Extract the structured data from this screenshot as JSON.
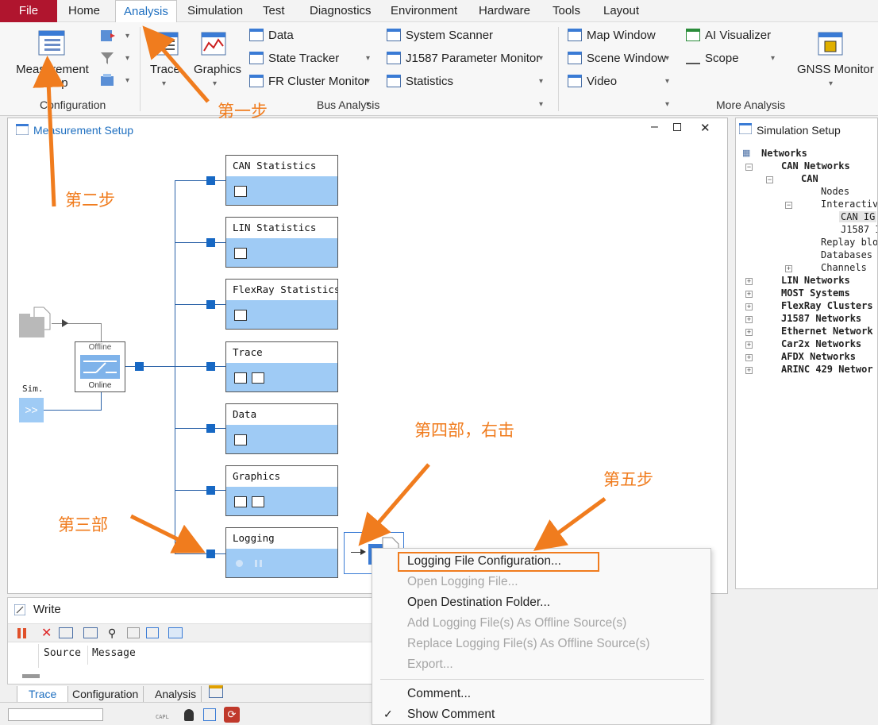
{
  "menu": {
    "tabs": [
      "File",
      "Home",
      "Analysis",
      "Simulation",
      "Test",
      "Diagnostics",
      "Environment",
      "Hardware",
      "Tools",
      "Layout"
    ],
    "active": "Analysis"
  },
  "ribbon": {
    "configuration": {
      "measurement_setup": "Measurement Setup",
      "group_label": "Configuration"
    },
    "bus_analysis": {
      "trace": "Trace",
      "graphics": "Graphics",
      "data": "Data",
      "state_tracker": "State Tracker",
      "fr_cluster_monitor": "FR Cluster Monitor",
      "system_scanner": "System Scanner",
      "j1587_monitor": "J1587 Parameter Monitor",
      "statistics": "Statistics",
      "group_label": "Bus Analysis"
    },
    "more_analysis": {
      "map_window": "Map Window",
      "scene_window": "Scene Window",
      "video": "Video",
      "ai_visualizer": "AI Visualizer",
      "scope": "Scope",
      "gnss_monitor": "GNSS Monitor",
      "group_label": "More Analysis"
    }
  },
  "measurement_setup": {
    "title": "Measurement Setup",
    "switch": {
      "offline": "Offline",
      "online": "Online"
    },
    "sim_label": "Sim.",
    "sim_glyph": ">>",
    "blocks": [
      "CAN Statistics",
      "LIN Statistics",
      "FlexRay Statistics",
      "Trace",
      "Data",
      "Graphics",
      "Logging"
    ]
  },
  "simulation_setup": {
    "title": "Simulation Setup",
    "tree": {
      "networks": "Networks",
      "can_networks": "CAN Networks",
      "can": "CAN",
      "nodes": "Nodes",
      "interactive": "Interactive",
      "can_ig": "CAN IG",
      "j1587": "J1587 I",
      "replay": "Replay bloc",
      "databases": "Databases",
      "channels": "Channels",
      "lin": "LIN Networks",
      "most": "MOST Systems",
      "flexray": "FlexRay Clusters",
      "j1587_networks": "J1587 Networks",
      "ethernet": "Ethernet Network",
      "car2x": "Car2x Networks",
      "afdx": "AFDX Networks",
      "arinc": "ARINC 429 Networ"
    }
  },
  "write_pane": {
    "title": "Write",
    "columns": [
      "Source",
      "Message"
    ]
  },
  "bottom_tabs": [
    "Trace",
    "Configuration",
    "Analysis"
  ],
  "status": {
    "capl": "CAPL"
  },
  "context_menu": {
    "items": [
      {
        "label": "Logging File Configuration...",
        "enabled": true,
        "highlighted": true
      },
      {
        "label": "Open Logging File...",
        "enabled": false
      },
      {
        "label": "Open Destination Folder...",
        "enabled": true
      },
      {
        "label": "Add Logging File(s) As Offline Source(s)",
        "enabled": false
      },
      {
        "label": "Replace Logging File(s) As Offline Source(s)",
        "enabled": false
      },
      {
        "label": "Export...",
        "enabled": false
      },
      {
        "label": "Comment...",
        "enabled": true
      },
      {
        "label": "Show Comment",
        "enabled": true,
        "checked": true
      }
    ]
  },
  "annotations": {
    "step1": "第一步",
    "step2": "第二步",
    "step3": "第三部",
    "step4": "第四部，右击",
    "step5": "第五步"
  },
  "colors": {
    "accent": "#1e6fc0",
    "file_tab": "#b0152e",
    "block_body": "#9fcbf5",
    "node": "#1768c4",
    "annotation": "#f07c1e"
  }
}
